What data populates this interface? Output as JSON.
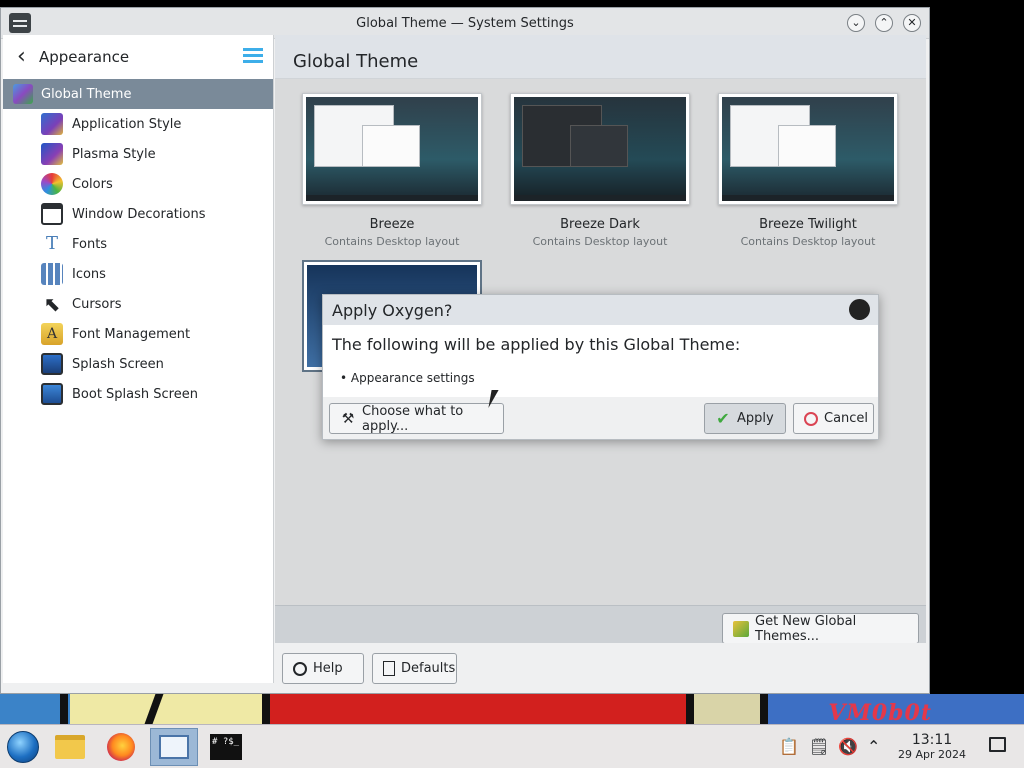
{
  "window": {
    "title": "Global Theme — System Settings",
    "minimize_glyph": "⌄",
    "maximize_glyph": "⌃",
    "close_glyph": "✕"
  },
  "sidebar": {
    "back_label": "Appearance",
    "selected": {
      "label": "Global Theme",
      "icon": "global-theme-icon"
    },
    "items": [
      {
        "label": "Application Style",
        "icon": "application-style-icon"
      },
      {
        "label": "Plasma Style",
        "icon": "plasma-style-icon"
      },
      {
        "label": "Colors",
        "icon": "colors-icon"
      },
      {
        "label": "Window Decorations",
        "icon": "window-decorations-icon"
      },
      {
        "label": "Fonts",
        "icon": "fonts-icon"
      },
      {
        "label": "Icons",
        "icon": "icons-icon"
      },
      {
        "label": "Cursors",
        "icon": "cursors-icon"
      },
      {
        "label": "Font Management",
        "icon": "font-management-icon"
      },
      {
        "label": "Splash Screen",
        "icon": "splash-screen-icon"
      },
      {
        "label": "Boot Splash Screen",
        "icon": "boot-splash-screen-icon"
      }
    ]
  },
  "content": {
    "title": "Global Theme",
    "themes": [
      {
        "name": "Breeze",
        "subtitle": "Contains Desktop layout",
        "style": "light"
      },
      {
        "name": "Breeze Dark",
        "subtitle": "Contains Desktop layout",
        "style": "dark"
      },
      {
        "name": "Breeze Twilight",
        "subtitle": "Contains Desktop layout",
        "style": "twilight"
      }
    ],
    "get_new_label": "Get New Global Themes...",
    "help_label": "Help",
    "defaults_label": "Defaults"
  },
  "dialog": {
    "title": "Apply Oxygen?",
    "heading": "The following will be applied by this Global Theme:",
    "list_item": "• Appearance settings",
    "choose_label": "Choose what to apply...",
    "apply_label": "Apply",
    "cancel_label": "Cancel"
  },
  "taskbar": {
    "time": "13:11",
    "date": "29 Apr 2024",
    "terminal_text": "# ?$_"
  },
  "wallpaper": {
    "mark": "VM0b0t"
  },
  "colors": {
    "accent": "#3daee9",
    "selection": "#7a8a99"
  }
}
